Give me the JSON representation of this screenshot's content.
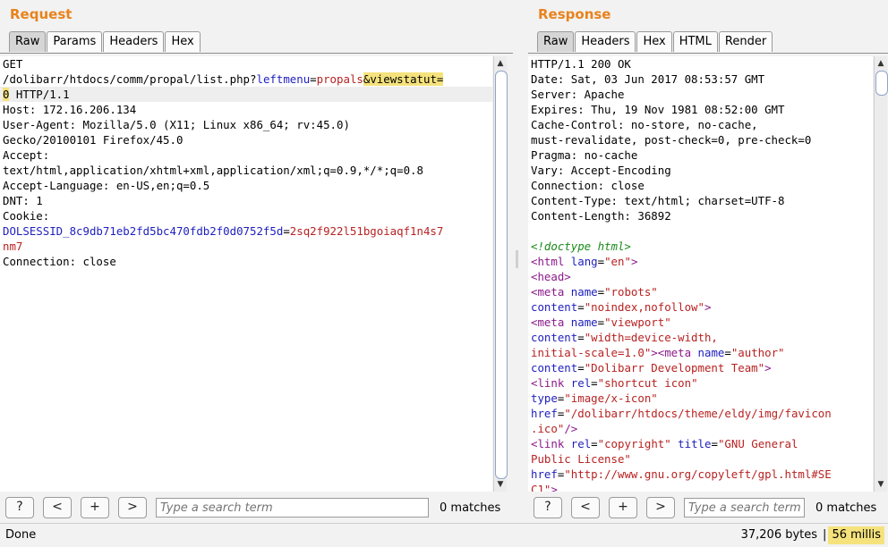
{
  "request": {
    "title": "Request",
    "tabs": [
      "Raw",
      "Params",
      "Headers",
      "Hex"
    ],
    "line1": "GET",
    "line2_path": "/dolibarr/htdocs/comm/propal/list.php?",
    "line2_param1": "leftmenu",
    "line2_eq": "=",
    "line2_value1": "propals",
    "line2_hl": "&viewstatut=",
    "line3_hl": "0",
    "line3_rest": " HTTP/1.1",
    "host": "Host: 172.16.206.134",
    "ua1": "User-Agent: Mozilla/5.0 (X11; Linux x86_64; rv:45.0)",
    "ua2": "Gecko/20100101 Firefox/45.0",
    "accept_label": "Accept:",
    "accept_value": "text/html,application/xhtml+xml,application/xml;q=0.9,*/*;q=0.8",
    "accept_lang": "Accept-Language: en-US,en;q=0.5",
    "dnt": "DNT: 1",
    "cookie_label": "Cookie:",
    "cookie_name": "DOLSESSID_8c9db71eb2fd5bc470fdb2f0d0752f5d",
    "cookie_eq": "=",
    "cookie_value1": "2sq2f922l51bgoiaqf1n4s7",
    "cookie_value2": "nm7",
    "connection": "Connection: close",
    "search_placeholder": "Type a search term",
    "matches": "0 matches"
  },
  "response": {
    "title": "Response",
    "tabs": [
      "Raw",
      "Headers",
      "Hex",
      "HTML",
      "Render"
    ],
    "headers": [
      "HTTP/1.1 200 OK",
      "Date: Sat, 03 Jun 2017 08:53:57 GMT",
      "Server: Apache",
      "Expires: Thu, 19 Nov 1981 08:52:00 GMT",
      "Cache-Control: no-store, no-cache,",
      "must-revalidate, post-check=0, pre-check=0",
      "Pragma: no-cache",
      "Vary: Accept-Encoding",
      "Connection: close",
      "Content-Type: text/html; charset=UTF-8",
      "Content-Length: 36892"
    ],
    "doctype": "<!doctype html>",
    "html_tag": "<html",
    "lang_attr": "lang",
    "lang_val": "\"en\"",
    "gt": ">",
    "head_tag": "<head>",
    "meta_tag": "<meta",
    "name_attr": "name",
    "robots_val": "\"robots\"",
    "content_attr": "content",
    "robots_content": "\"noindex,nofollow\"",
    "viewport_val": "\"viewport\"",
    "viewport_content1": "\"width=device-width,",
    "viewport_content2": "initial-scale=1.0\"",
    "author_val": "\"author\"",
    "author_content": "\"Dolibarr Development Team\"",
    "link_tag": "<link",
    "rel_attr": "rel",
    "shortcut_val": "\"shortcut icon\"",
    "type_attr": "type",
    "type_val": "\"image/x-icon\"",
    "href_attr": "href",
    "href_val1": "\"/dolibarr/htdocs/theme/eldy/img/favicon",
    "href_val2": ".ico\"",
    "selfclose": "/>",
    "copyright_val": "\"copyright\"",
    "title_attr": "title",
    "gnu_val1": "\"GNU General",
    "gnu_val2": "Public License\"",
    "gpl_val1": "\"http://www.gnu.org/copyleft/gpl.html#SE",
    "gpl_val2": "C1\"",
    "search_placeholder": "Type a search term",
    "matches": "0 matches"
  },
  "search_buttons": [
    "?",
    "<",
    "+",
    ">"
  ],
  "status": {
    "left": "Done",
    "bytes": "37,206 bytes",
    "sep": "|",
    "millis": "56 millis"
  }
}
